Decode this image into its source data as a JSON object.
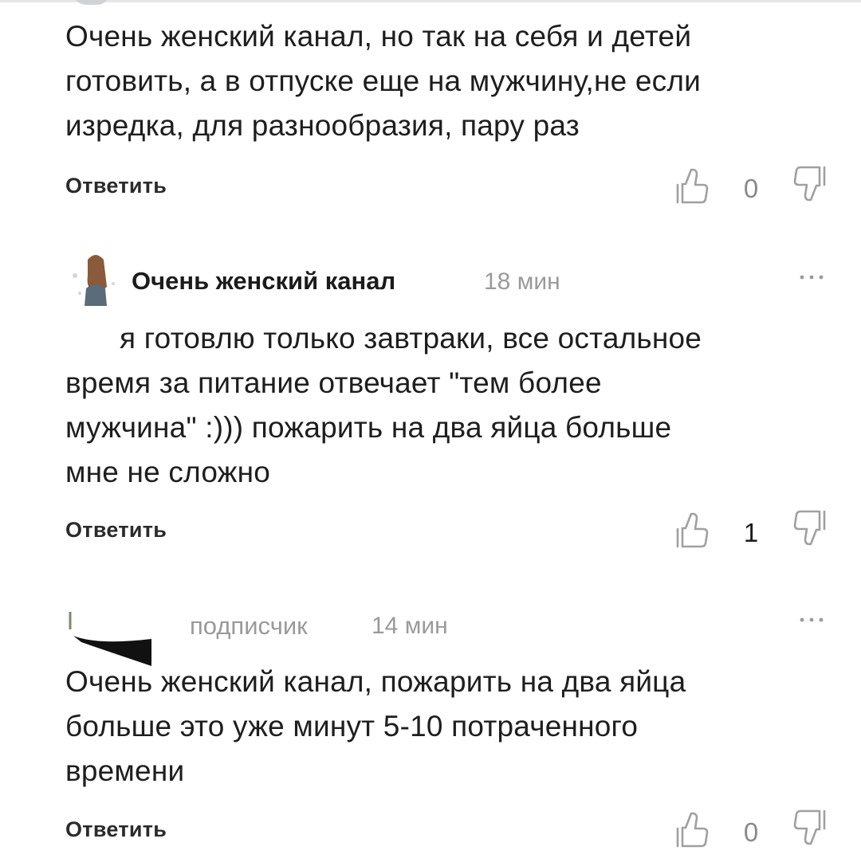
{
  "comments": [
    {
      "text_lines": [
        "Очень женский канал, но так на себя и детей",
        "готовить, а в отпуске еще на мужчину,не если",
        "изредка, для разнообразия, пару раз"
      ],
      "reply_label": "Ответить",
      "likes": "0"
    },
    {
      "author": "Очень женский канал",
      "time": "18 мин",
      "text_lines": [
        "я готовлю только завтраки, все остальное",
        "время за питание отвечает \"тем более",
        "мужчина\" :))) пожарить на два яйца больше",
        "мне не сложно"
      ],
      "reply_label": "Ответить",
      "likes": "1"
    },
    {
      "author": "подписчик",
      "time": "14 мин",
      "text_lines": [
        "Очень женский канал, пожарить на два яйца",
        "больше это уже минут 5-10 потраченного",
        "времени"
      ],
      "reply_label": "Ответить",
      "likes": "0"
    }
  ],
  "icons": {
    "like": "thumbs-up-outline-icon",
    "dislike": "thumbs-down-outline-icon",
    "more": "more-dots-icon"
  },
  "colors": {
    "text": "#1e1e1e",
    "muted": "#9a9a9a",
    "icon": "#a0a0a0"
  }
}
